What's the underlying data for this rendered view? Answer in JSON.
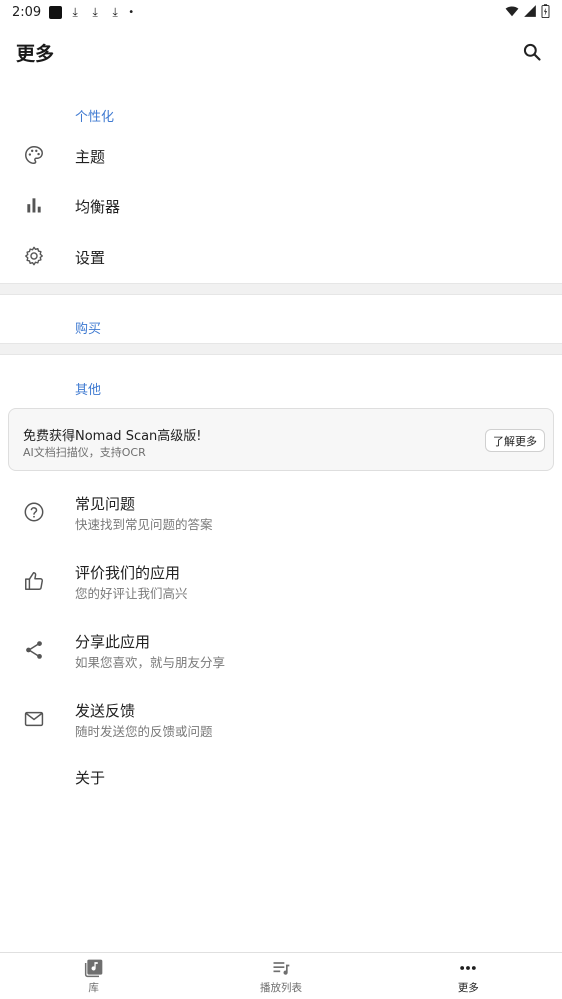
{
  "status": {
    "time": "2:09"
  },
  "header": {
    "title": "更多"
  },
  "sections": {
    "personalize": "个性化",
    "purchase": "购买",
    "other": "其他"
  },
  "menu": {
    "theme": "主题",
    "equalizer": "均衡器",
    "settings": "设置",
    "faq": {
      "label": "常见问题",
      "sub": "快速找到常见问题的答案"
    },
    "rate": {
      "label": "评价我们的应用",
      "sub": "您的好评让我们高兴"
    },
    "share": {
      "label": "分享此应用",
      "sub": "如果您喜欢，就与朋友分享"
    },
    "feedback": {
      "label": "发送反馈",
      "sub": "随时发送您的反馈或问题"
    },
    "about": "关于"
  },
  "promo": {
    "title": "免费获得Nomad Scan高级版!",
    "subtitle": "AI文档扫描仪，支持OCR",
    "button": "了解更多"
  },
  "bottom_nav": [
    {
      "label": "库",
      "icon": "library-icon"
    },
    {
      "label": "播放列表",
      "icon": "playlist-icon"
    },
    {
      "label": "更多",
      "icon": "more-icon"
    }
  ],
  "colors": {
    "accent": "#3f7ad1",
    "icon_gray": "#555555"
  }
}
